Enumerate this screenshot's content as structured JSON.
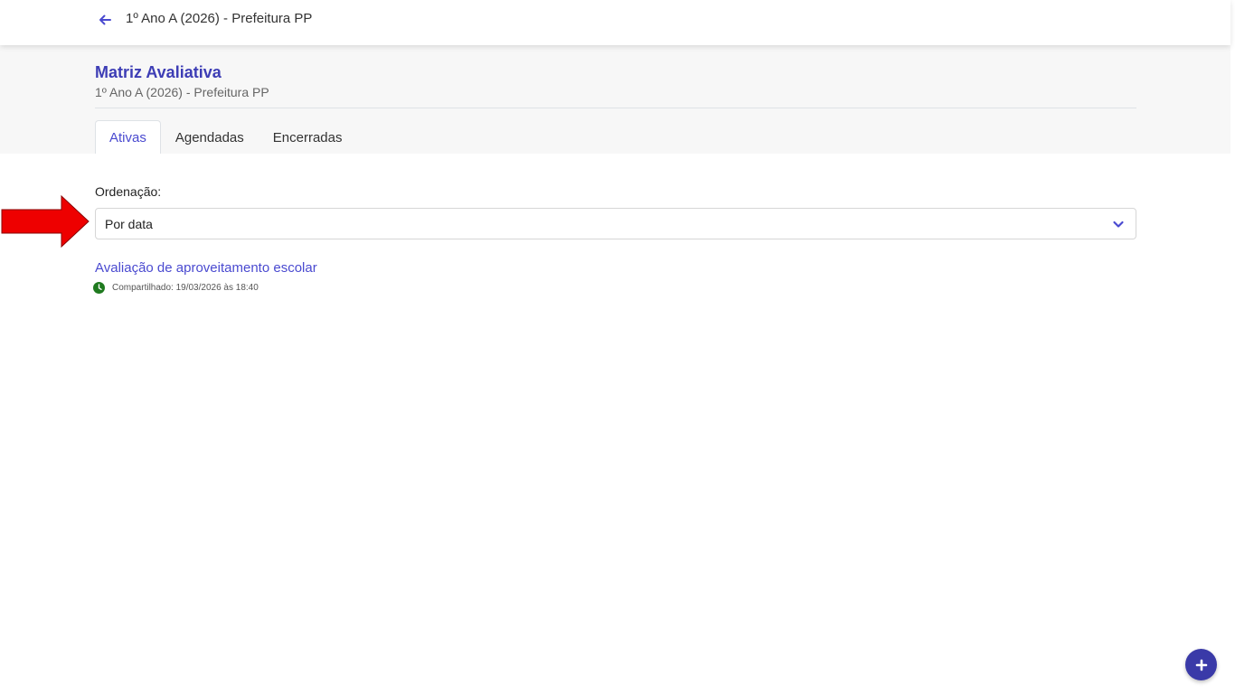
{
  "topbar": {
    "title": "1º Ano A (2026) - Prefeitura PP",
    "back_icon": "arrow-left-icon"
  },
  "header": {
    "title": "Matriz Avaliativa",
    "subtitle": "1º Ano A (2026) - Prefeitura PP"
  },
  "tabs": [
    {
      "label": "Ativas",
      "active": true
    },
    {
      "label": "Agendadas",
      "active": false
    },
    {
      "label": "Encerradas",
      "active": false
    }
  ],
  "sort": {
    "label": "Ordenação:",
    "selected": "Por data",
    "icon": "chevron-down-icon"
  },
  "evaluations": [
    {
      "title": "Avaliação de aproveitamento escolar",
      "shared": "Compartilhado: 19/03/2026 às 18:40",
      "status_icon": "clock-icon"
    }
  ],
  "fab": {
    "icon": "plus-icon"
  },
  "colors": {
    "accent": "#4a4ad0",
    "title": "#3d3db5",
    "fab": "#3a3aa8",
    "status_green": "#1f7a1f",
    "annotation_red": "#ee0000"
  }
}
